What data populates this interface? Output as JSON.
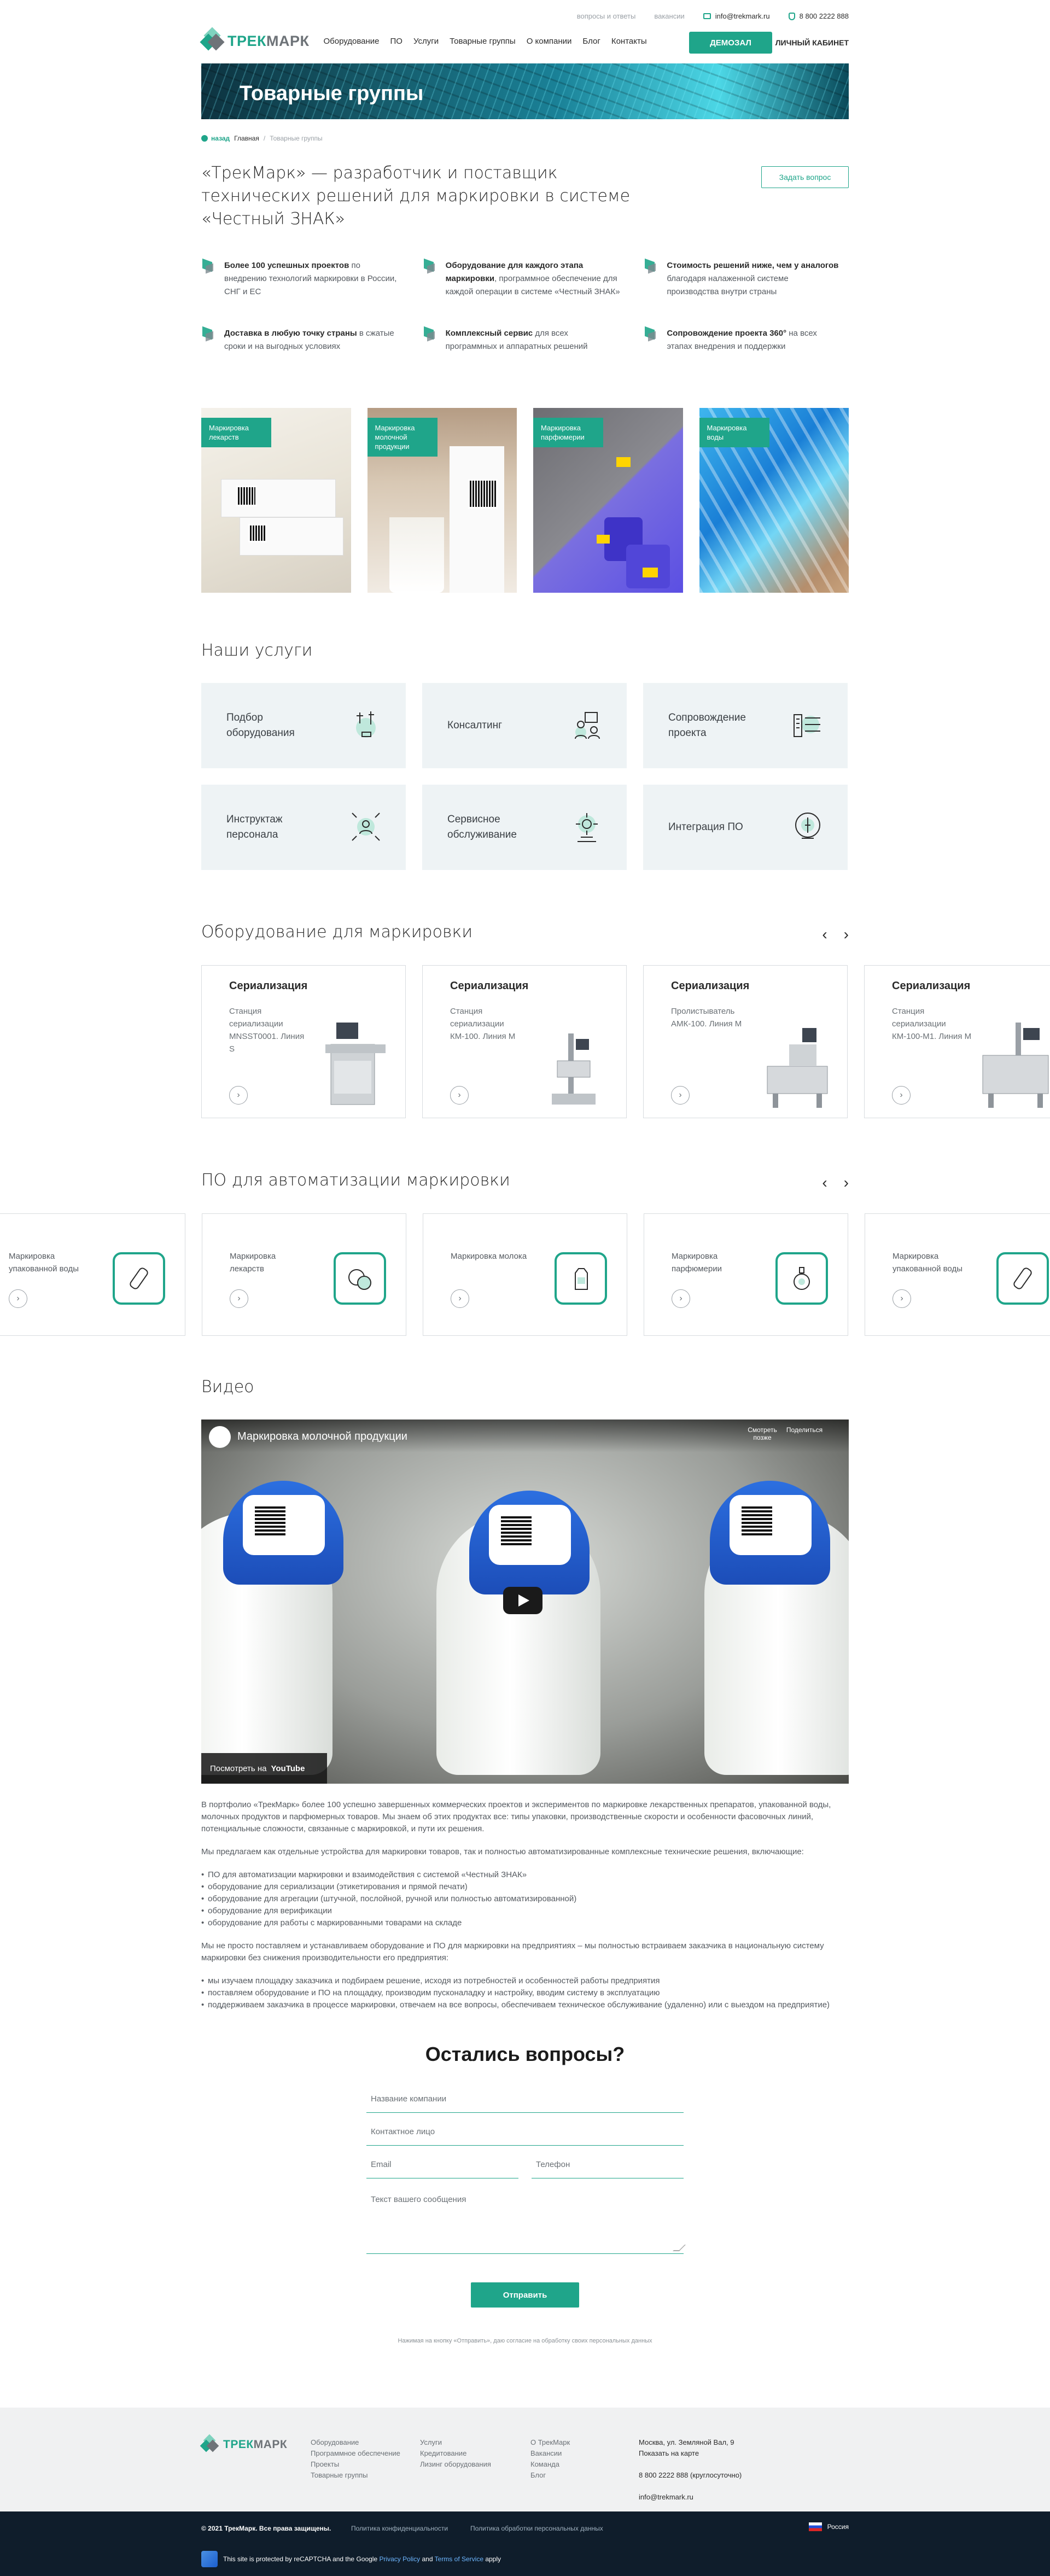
{
  "topbar": {
    "faq": "вопросы и ответы",
    "vacancies": "вакансии",
    "email": "info@trekmark.ru",
    "phone": "8 800 2222 888"
  },
  "header": {
    "logo_a": "ТРЕК",
    "logo_b": "МАРК",
    "nav": [
      "Оборудование",
      "ПО",
      "Услуги",
      "Товарные группы",
      "О компании",
      "Блог",
      "Контакты"
    ],
    "demo": "Демозал",
    "cabinet": "Личный кабинет"
  },
  "banner": {
    "title": "Товарные группы"
  },
  "breadcrumbs": {
    "back": "назад",
    "home": "Главная",
    "current": "Товарные группы"
  },
  "lead": {
    "title": "«ТрекМарк» — разработчик и поставщик технических решений для маркировки в системе «Честный ЗНАК»",
    "ask": "Задать вопрос"
  },
  "advantages": [
    {
      "bold": "Более 100 успешных проектов",
      "text": " по внедрению технологий маркировки в России, СНГ и ЕС"
    },
    {
      "bold": "Оборудование для каждого этапа маркировки",
      "text": ", программное обеспечение для каждой операции в системе «Честный ЗНАК»"
    },
    {
      "bold": "Стоимость решений ниже, чем у аналогов",
      "text": " благодаря налаженной системе производства внутри страны"
    },
    {
      "bold": "Доставка в любую точку страны",
      "text": " в сжатые сроки и на выгодных условиях"
    },
    {
      "bold": "Комплексный сервис",
      "text": " для всех программных и аппаратных решений"
    },
    {
      "bold": "Сопровождение проекта 360°",
      "text": " на всех этапах внедрения и поддержки"
    }
  ],
  "groups": [
    {
      "label": "Маркировка лекарств"
    },
    {
      "label": "Маркировка молочной продукции"
    },
    {
      "label": "Маркировка парфюмерии"
    },
    {
      "label": "Маркировка воды"
    }
  ],
  "services": {
    "title": "Наши услуги",
    "items": [
      {
        "label": "Подбор оборудования",
        "icon": "equipment-selection-icon"
      },
      {
        "label": "Консалтинг",
        "icon": "consulting-icon"
      },
      {
        "label": "Сопровождение проекта",
        "icon": "project-support-icon"
      },
      {
        "label": "Инструктаж персонала",
        "icon": "staff-training-icon"
      },
      {
        "label": "Сервисное обслуживание",
        "icon": "service-maintenance-icon"
      },
      {
        "label": "Интеграция ПО",
        "icon": "software-integration-icon"
      }
    ]
  },
  "equipment": {
    "title": "Оборудование для маркировки",
    "items": [
      {
        "category": "Сериализация",
        "name": "Станция сериализации MNSST0001. Линия S"
      },
      {
        "category": "Сериализация",
        "name": "Станция сериализации КМ-100. Линия М"
      },
      {
        "category": "Сериализация",
        "name": "Пролистыватель АМК-100. Линия М"
      },
      {
        "category": "Сериализация",
        "name": "Станция сериализации КМ-100-М1. Линия М"
      }
    ]
  },
  "software": {
    "title": "ПО для автоматизации маркировки",
    "items": [
      {
        "label": "Маркировка упакованной воды",
        "icon": "water-bottle-icon"
      },
      {
        "label": "Маркировка лекарств",
        "icon": "pills-icon"
      },
      {
        "label": "Маркировка молока",
        "icon": "milk-carton-icon"
      },
      {
        "label": "Маркировка парфюмерии",
        "icon": "perfume-icon"
      },
      {
        "label": "Маркировка упакованной воды",
        "icon": "water-bottle-icon"
      }
    ]
  },
  "video": {
    "title": "Видео",
    "video_title": "Маркировка молочной продукции",
    "later": "Смотреть позже",
    "share": "Поделиться",
    "watch_on": "Посмотреть на",
    "youtube": "YouTube"
  },
  "article": {
    "p1": "В портфолио «ТрекМарк» более 100 успешно завершенных коммерческих проектов и экспериментов по маркировке лекарственных препаратов, упакованной воды, молочных продуктов и парфюмерных товаров. Мы знаем об этих продуктах все: типы упаковки, производственные скорости и особенности фасовочных линий, потенциальные сложности, связанные с маркировкой, и пути их решения.",
    "p2": "Мы предлагаем как отдельные устройства для маркировки товаров, так и полностью автоматизированные комплексные технические решения, включающие:",
    "list1": [
      "ПО для автоматизации маркировки и взаимодействия с системой «Честный ЗНАК»",
      "оборудование для сериализации (этикетирования и прямой печати)",
      "оборудование для агрегации (штучной, послойной, ручной или полностью автоматизированной)",
      "оборудование для верификации",
      "оборудование для работы с маркированными товарами на складе"
    ],
    "p3": "Мы не просто поставляем и устанавливаем оборудование и ПО для маркировки на предприятиях – мы полностью встраиваем заказчика в национальную систему маркировки без снижения производительности его предприятия:",
    "list2": [
      "мы изучаем площадку заказчика и подбираем решение, исходя из потребностей и особенностей работы предприятия",
      "поставляем оборудование и ПО на площадку, производим пусконаладку и настройку, вводим систему в эксплуатацию",
      "поддерживаем заказчика в процессе маркировки, отвечаем на все вопросы, обеспечиваем техническое обслуживание (удаленно) или с выездом на предприятие)"
    ]
  },
  "form": {
    "title": "Остались вопросы?",
    "company": "Название компании",
    "contact": "Контактное лицо",
    "email": "Email",
    "phone": "Телефон",
    "message": "Текст вашего сообщения",
    "submit": "Отправить",
    "consent": "Нажимая на кнопку «Отправить», даю согласие на обработку своих персональных данных"
  },
  "footer": {
    "col1": [
      "Оборудование",
      "Программное обеспечение",
      "Проекты",
      "Товарные группы"
    ],
    "col2": [
      "Услуги",
      "Кредитование",
      "Лизинг оборудования"
    ],
    "col3": [
      "О ТрекМарк",
      "Вакансии",
      "Команда",
      "Блог"
    ],
    "address": "Москва, ул. Земляной Вал, 9",
    "map": "Показать на карте",
    "phone": "8 800 2222 888 (круглосуточно)",
    "email": "info@trekmark.ru"
  },
  "bottom": {
    "copyright": "© 2021 ТрекМарк. Все права защищены.",
    "privacy": "Политика конфиденциальности",
    "personal": "Политика обработки персональных данных",
    "lang": "Россия",
    "recaptcha_a": "This site is protected by reCAPTCHA and the Google ",
    "recaptcha_b": "Privacy Policy",
    "recaptcha_c": " and ",
    "recaptcha_d": "Terms of Service",
    "recaptcha_e": " apply"
  },
  "colors": {
    "accent": "#1fa58a",
    "dark": "#0f1d2b",
    "light_bg": "#eef3f5"
  }
}
